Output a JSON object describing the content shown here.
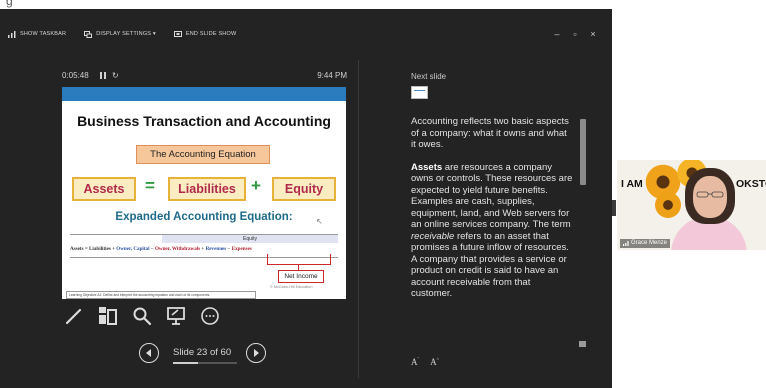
{
  "top_strip_text": "g",
  "toolbar": {
    "show_taskbar": "SHOW TASKBAR",
    "display_settings": "DISPLAY SETTINGS ▾",
    "end_slide_show": "END SLIDE SHOW"
  },
  "window_controls": {
    "minimize": "–",
    "restore": "▫",
    "close": "×"
  },
  "timer": {
    "elapsed": "0:05:48",
    "clock": "9:44 PM"
  },
  "slide": {
    "title": "Business Transaction and Accounting",
    "equation_box": "The Accounting Equation",
    "terms": [
      "Assets",
      "Liabilities",
      "Equity"
    ],
    "ops": [
      "=",
      "+"
    ],
    "expanded_title": "Expanded Accounting Equation:",
    "equity_header": "Equity",
    "expanded_eq": {
      "p1": "Assets = Liabilities + ",
      "p2": "Owner, Capital",
      "p3": " − ",
      "p4": "Owner, Withdrawals",
      "p5": " + ",
      "p6": "Revenues",
      "p7": " − ",
      "p8": "Expenses"
    },
    "net_income": "Net Income",
    "copyright": "© McGraw-Hill Education",
    "learning_objective": "Learning Objective A1: Define and interpret the accounting equation and each of its components."
  },
  "tools": [
    "pen-icon",
    "see-all-slides-icon",
    "zoom-icon",
    "pointer-monitor-icon",
    "more-options-icon"
  ],
  "nav": {
    "label": "Slide 23 of 60",
    "current": 23,
    "total": 60
  },
  "next_slide_label": "Next slide",
  "notes": {
    "p1": "Accounting reflects two basic aspects of a company: what it owns and what it owes.",
    "p2_bold": "Assets",
    "p2_a": " are resources a company owns or controls. These resources are expected to yield future benefits. Examples are cash, supplies, equipment, land, and Web servers for an online services company. The term ",
    "p2_italic": "receivable",
    "p2_b": " refers to an asset that promises a future inflow of resources. A company that provides a service or product on credit is said to have an account receivable from that customer."
  },
  "font_buttons": [
    "A",
    "A"
  ],
  "video": {
    "left_text": "I AM",
    "right_text": "OKSTON",
    "name": "Grace Menze"
  },
  "colors": {
    "background": "#232323",
    "slide_header": "#2b7bbf",
    "term_text": "#b22a4b",
    "plus_equals": "#2e9a3d",
    "expanded_title": "#1e6a8a"
  }
}
